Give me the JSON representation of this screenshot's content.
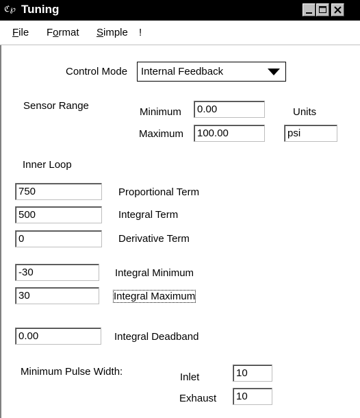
{
  "window": {
    "icon_glyph": "ℭ℘",
    "title": "Tuning",
    "controls": [
      "minimize-icon",
      "maximize-icon",
      "close-icon"
    ]
  },
  "menu": {
    "items": [
      {
        "label": "File",
        "accel": "F",
        "rest": "ile"
      },
      {
        "label": "Format",
        "accel": "o",
        "pre": "F",
        "rest": "rmat"
      },
      {
        "label": "Simple",
        "accel": "S",
        "rest": "imple"
      },
      {
        "label": "!",
        "accel": "",
        "rest": "!"
      }
    ]
  },
  "control_mode": {
    "label": "Control Mode",
    "value": "Internal Feedback",
    "arrow_icon": "dropdown-arrow-icon"
  },
  "sensor_range": {
    "label": "Sensor Range",
    "minimum_label": "Minimum",
    "minimum_value": "0.00",
    "maximum_label": "Maximum",
    "maximum_value": "100.00",
    "units_label": "Units",
    "units_value": "psi"
  },
  "inner_loop": {
    "label": "Inner Loop",
    "proportional_value": "750",
    "proportional_label": "Proportional Term",
    "integral_value": "500",
    "integral_label": "Integral Term",
    "derivative_value": "0",
    "derivative_label": "Derivative Term",
    "integral_min_value": "-30",
    "integral_min_label": "Integral Minimum",
    "integral_max_value": "30",
    "integral_max_label": "Integral Maximum",
    "deadband_value": "0.00",
    "deadband_label": "Integral Deadband"
  },
  "pulse_width": {
    "label": "Minimum Pulse Width:",
    "inlet_label": "Inlet",
    "inlet_value": "10",
    "exhaust_label": "Exhaust",
    "exhaust_value": "10"
  }
}
